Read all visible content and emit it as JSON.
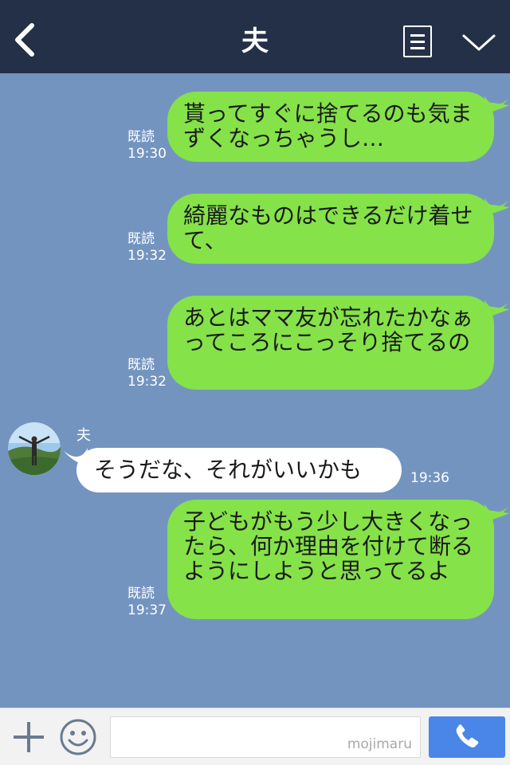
{
  "header": {
    "title": "夫",
    "back_icon": "chevron-left-icon",
    "menu_icon": "list-icon",
    "expand_icon": "chevron-down-icon"
  },
  "messages": [
    {
      "side": "out",
      "text": "貰ってすぐに捨てるのも気まずくなっちゃうし…",
      "read": "既読",
      "time": "19:30"
    },
    {
      "side": "out",
      "text": "綺麗なものはできるだけ着せて、",
      "read": "既読",
      "time": "19:32"
    },
    {
      "side": "out",
      "text": "あとはママ友が忘れたかなぁってころにこっそり捨てるの",
      "read": "既読",
      "time": "19:32"
    },
    {
      "side": "in",
      "sender": "夫",
      "text": "そうだな、それがいいかも",
      "time": "19:36"
    },
    {
      "side": "out",
      "text": "子どもがもう少し大きくなったら、何か理由を付けて断るようにしようと思ってるよ",
      "read": "既読",
      "time": "19:37"
    }
  ],
  "footer": {
    "plus_icon": "plus-icon",
    "emoji_icon": "smiley-icon",
    "input_value": "",
    "watermark": "mojimaru",
    "call_icon": "phone-icon"
  },
  "colors": {
    "header_bg": "#243048",
    "chat_bg": "#7494c0",
    "outgoing_bubble": "#85e249",
    "incoming_bubble": "#ffffff",
    "call_button": "#4a86e8"
  }
}
